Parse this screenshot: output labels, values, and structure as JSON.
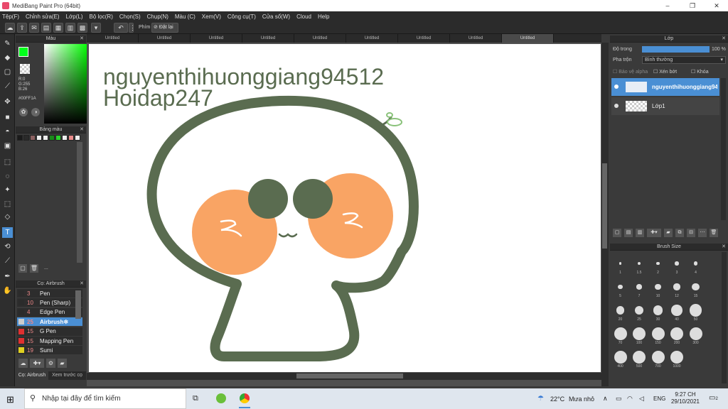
{
  "window": {
    "title": "MediBang Paint Pro (64bit)"
  },
  "menu": [
    "Tệp(F)",
    "Chỉnh sửa(E)",
    "Lớp(L)",
    "Bộ lọc(R)",
    "Chọn(S)",
    "Chụp(N)",
    "Màu (C)",
    "Xem(V)",
    "Công cụ(T)",
    "Cửa sổ(W)",
    "Cloud",
    "Help"
  ],
  "toolbar": {
    "key_label": "Phím",
    "reset_label": "Đặt lại"
  },
  "tabs": [
    "Untitled",
    "Untitled",
    "Untitled",
    "Untitled",
    "Untitled",
    "Untitled",
    "Untitled",
    "Untitled",
    "Untitled"
  ],
  "color_panel": {
    "title": "Màu",
    "fg_color": "#00FF1A",
    "r": "R:0",
    "g": "G:255",
    "b": "B:26",
    "hex": "#00FF1A"
  },
  "swatch_panel": {
    "title": "Bảng màu",
    "swatches": [
      "#1a1a1a",
      "#2a2a2a",
      "#8a6060",
      "#eeeeee",
      "#eeeeee",
      "#1a8a1a",
      "#2bd42b",
      "#eeeeee",
      "#e88a8a",
      "#eeeeee"
    ],
    "more": "..."
  },
  "brush_panel": {
    "title": "Cọ: Airbrush",
    "items": [
      {
        "size": "3",
        "name": "Pen",
        "color": "#2b2b2b"
      },
      {
        "size": "10",
        "name": "Pen (Sharp)",
        "color": "#2b2b2b"
      },
      {
        "size": "4",
        "name": "Edge Pen",
        "color": "#2b2b2b"
      },
      {
        "size": "25",
        "name": "Airbrush",
        "color": "#cccccc"
      },
      {
        "size": "15",
        "name": "G Pen",
        "color": "#e03030"
      },
      {
        "size": "15",
        "name": "Mapping Pen",
        "color": "#e03030"
      },
      {
        "size": "19",
        "name": "Sumi",
        "color": "#e0d020"
      }
    ],
    "bottom_tabs": [
      "Cọ: Airbrush",
      "Xem trước cọ"
    ]
  },
  "canvas": {
    "line1": "nguyenthihuonggiang94512",
    "line2": "Hoidap247",
    "ink_color": "#5a6c50",
    "cheek_color": "#f9a464"
  },
  "layer_panel": {
    "title": "Lớp",
    "opacity_label": "Độ trong",
    "opacity_value": "100 %",
    "opacity_fraction": 1.0,
    "blend_label": "Pha trộn",
    "blend_value": "Bình thường",
    "protect_alpha": "Bảo vệ alpha",
    "clip": "Xén bớt",
    "lock": "Khóa",
    "layers": [
      {
        "name": "nguyenthihuonggiang94512",
        "selected": true
      },
      {
        "name": "Lớp1",
        "selected": false
      }
    ]
  },
  "brushsize_panel": {
    "title": "Brush Size",
    "sizes": [
      "1",
      "1.5",
      "2",
      "3",
      "4",
      "5",
      "7",
      "10",
      "12",
      "15",
      "20",
      "25",
      "30",
      "40",
      "50",
      "70",
      "100",
      "150",
      "200",
      "300",
      "400",
      "500",
      "700",
      "1000"
    ]
  },
  "taskbar": {
    "search_placeholder": "Nhập tại đây để tìm kiếm",
    "temp": "22°C",
    "weather": "Mưa nhỏ",
    "lang": "ENG",
    "time": "9:27 CH",
    "date": "29/10/2021",
    "notif": "2"
  }
}
